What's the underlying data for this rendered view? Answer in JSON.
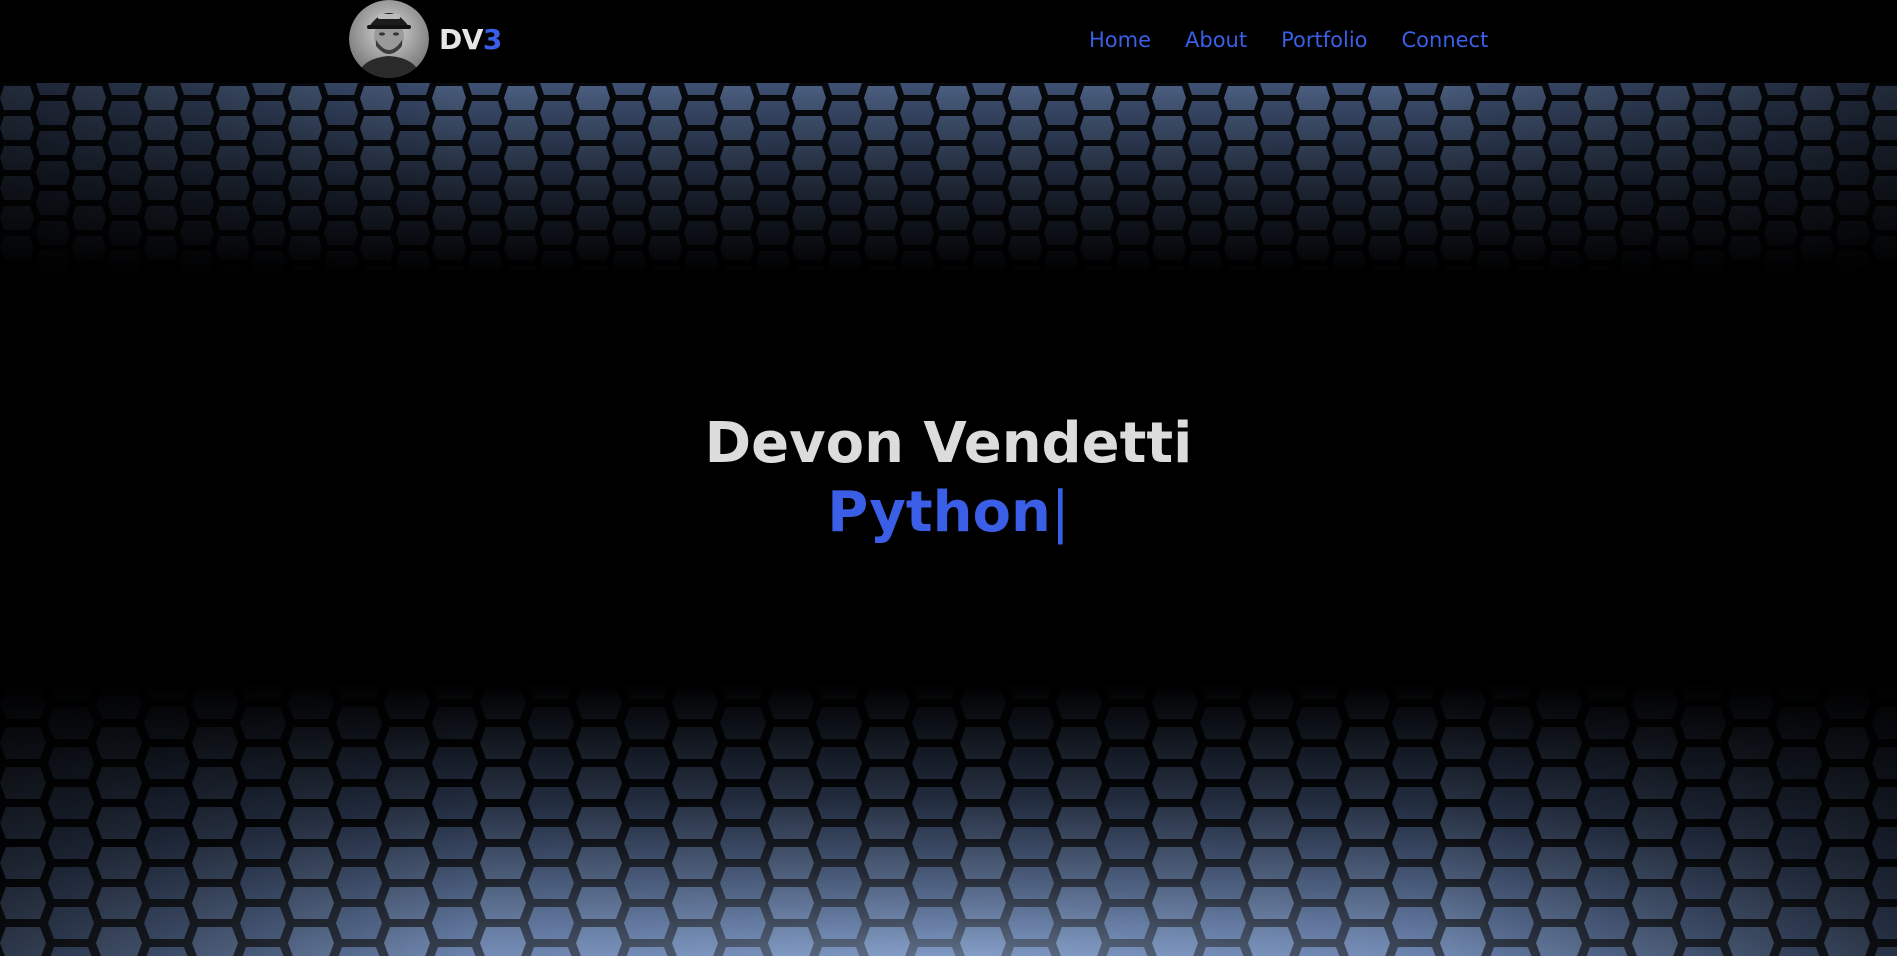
{
  "brand": {
    "text_main": "DV",
    "text_accent": "3",
    "avatar_icon": "portrait-avatar-icon"
  },
  "nav": {
    "items": [
      {
        "label": "Home"
      },
      {
        "label": "About"
      },
      {
        "label": "Portfolio"
      },
      {
        "label": "Connect"
      }
    ]
  },
  "hero": {
    "name": "Devon Vendetti",
    "role": "Python",
    "cursor": "|"
  },
  "colors": {
    "accent": "#3a5fe6",
    "text": "#dcdcdc",
    "background": "#000000",
    "hex_light": "#9bb5dd",
    "hex_dark": "#1b2434"
  }
}
